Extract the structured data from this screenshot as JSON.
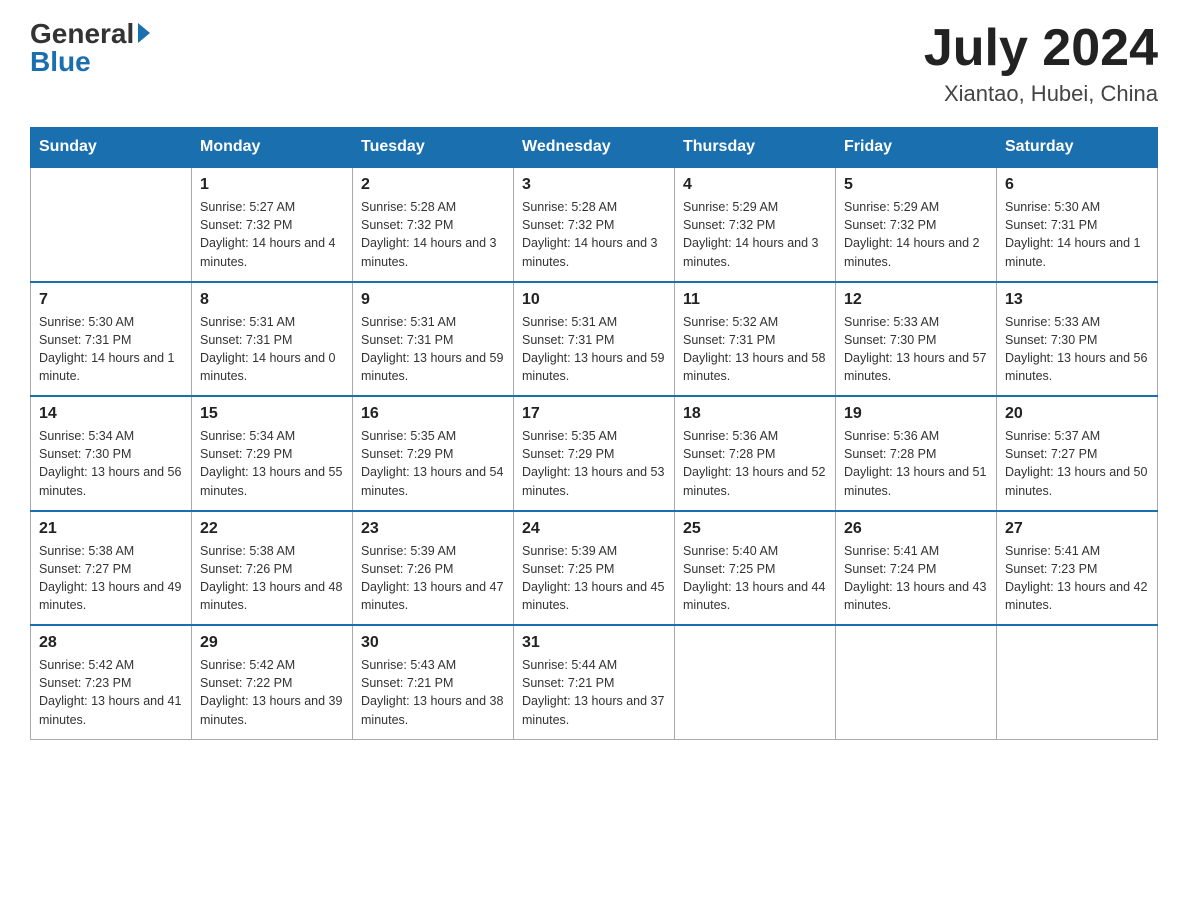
{
  "logo": {
    "general": "General",
    "blue": "Blue",
    "arrow": true
  },
  "title": {
    "month_year": "July 2024",
    "location": "Xiantao, Hubei, China"
  },
  "headers": [
    "Sunday",
    "Monday",
    "Tuesday",
    "Wednesday",
    "Thursday",
    "Friday",
    "Saturday"
  ],
  "weeks": [
    [
      {
        "day": "",
        "sunrise": "",
        "sunset": "",
        "daylight": ""
      },
      {
        "day": "1",
        "sunrise": "Sunrise: 5:27 AM",
        "sunset": "Sunset: 7:32 PM",
        "daylight": "Daylight: 14 hours and 4 minutes."
      },
      {
        "day": "2",
        "sunrise": "Sunrise: 5:28 AM",
        "sunset": "Sunset: 7:32 PM",
        "daylight": "Daylight: 14 hours and 3 minutes."
      },
      {
        "day": "3",
        "sunrise": "Sunrise: 5:28 AM",
        "sunset": "Sunset: 7:32 PM",
        "daylight": "Daylight: 14 hours and 3 minutes."
      },
      {
        "day": "4",
        "sunrise": "Sunrise: 5:29 AM",
        "sunset": "Sunset: 7:32 PM",
        "daylight": "Daylight: 14 hours and 3 minutes."
      },
      {
        "day": "5",
        "sunrise": "Sunrise: 5:29 AM",
        "sunset": "Sunset: 7:32 PM",
        "daylight": "Daylight: 14 hours and 2 minutes."
      },
      {
        "day": "6",
        "sunrise": "Sunrise: 5:30 AM",
        "sunset": "Sunset: 7:31 PM",
        "daylight": "Daylight: 14 hours and 1 minute."
      }
    ],
    [
      {
        "day": "7",
        "sunrise": "Sunrise: 5:30 AM",
        "sunset": "Sunset: 7:31 PM",
        "daylight": "Daylight: 14 hours and 1 minute."
      },
      {
        "day": "8",
        "sunrise": "Sunrise: 5:31 AM",
        "sunset": "Sunset: 7:31 PM",
        "daylight": "Daylight: 14 hours and 0 minutes."
      },
      {
        "day": "9",
        "sunrise": "Sunrise: 5:31 AM",
        "sunset": "Sunset: 7:31 PM",
        "daylight": "Daylight: 13 hours and 59 minutes."
      },
      {
        "day": "10",
        "sunrise": "Sunrise: 5:31 AM",
        "sunset": "Sunset: 7:31 PM",
        "daylight": "Daylight: 13 hours and 59 minutes."
      },
      {
        "day": "11",
        "sunrise": "Sunrise: 5:32 AM",
        "sunset": "Sunset: 7:31 PM",
        "daylight": "Daylight: 13 hours and 58 minutes."
      },
      {
        "day": "12",
        "sunrise": "Sunrise: 5:33 AM",
        "sunset": "Sunset: 7:30 PM",
        "daylight": "Daylight: 13 hours and 57 minutes."
      },
      {
        "day": "13",
        "sunrise": "Sunrise: 5:33 AM",
        "sunset": "Sunset: 7:30 PM",
        "daylight": "Daylight: 13 hours and 56 minutes."
      }
    ],
    [
      {
        "day": "14",
        "sunrise": "Sunrise: 5:34 AM",
        "sunset": "Sunset: 7:30 PM",
        "daylight": "Daylight: 13 hours and 56 minutes."
      },
      {
        "day": "15",
        "sunrise": "Sunrise: 5:34 AM",
        "sunset": "Sunset: 7:29 PM",
        "daylight": "Daylight: 13 hours and 55 minutes."
      },
      {
        "day": "16",
        "sunrise": "Sunrise: 5:35 AM",
        "sunset": "Sunset: 7:29 PM",
        "daylight": "Daylight: 13 hours and 54 minutes."
      },
      {
        "day": "17",
        "sunrise": "Sunrise: 5:35 AM",
        "sunset": "Sunset: 7:29 PM",
        "daylight": "Daylight: 13 hours and 53 minutes."
      },
      {
        "day": "18",
        "sunrise": "Sunrise: 5:36 AM",
        "sunset": "Sunset: 7:28 PM",
        "daylight": "Daylight: 13 hours and 52 minutes."
      },
      {
        "day": "19",
        "sunrise": "Sunrise: 5:36 AM",
        "sunset": "Sunset: 7:28 PM",
        "daylight": "Daylight: 13 hours and 51 minutes."
      },
      {
        "day": "20",
        "sunrise": "Sunrise: 5:37 AM",
        "sunset": "Sunset: 7:27 PM",
        "daylight": "Daylight: 13 hours and 50 minutes."
      }
    ],
    [
      {
        "day": "21",
        "sunrise": "Sunrise: 5:38 AM",
        "sunset": "Sunset: 7:27 PM",
        "daylight": "Daylight: 13 hours and 49 minutes."
      },
      {
        "day": "22",
        "sunrise": "Sunrise: 5:38 AM",
        "sunset": "Sunset: 7:26 PM",
        "daylight": "Daylight: 13 hours and 48 minutes."
      },
      {
        "day": "23",
        "sunrise": "Sunrise: 5:39 AM",
        "sunset": "Sunset: 7:26 PM",
        "daylight": "Daylight: 13 hours and 47 minutes."
      },
      {
        "day": "24",
        "sunrise": "Sunrise: 5:39 AM",
        "sunset": "Sunset: 7:25 PM",
        "daylight": "Daylight: 13 hours and 45 minutes."
      },
      {
        "day": "25",
        "sunrise": "Sunrise: 5:40 AM",
        "sunset": "Sunset: 7:25 PM",
        "daylight": "Daylight: 13 hours and 44 minutes."
      },
      {
        "day": "26",
        "sunrise": "Sunrise: 5:41 AM",
        "sunset": "Sunset: 7:24 PM",
        "daylight": "Daylight: 13 hours and 43 minutes."
      },
      {
        "day": "27",
        "sunrise": "Sunrise: 5:41 AM",
        "sunset": "Sunset: 7:23 PM",
        "daylight": "Daylight: 13 hours and 42 minutes."
      }
    ],
    [
      {
        "day": "28",
        "sunrise": "Sunrise: 5:42 AM",
        "sunset": "Sunset: 7:23 PM",
        "daylight": "Daylight: 13 hours and 41 minutes."
      },
      {
        "day": "29",
        "sunrise": "Sunrise: 5:42 AM",
        "sunset": "Sunset: 7:22 PM",
        "daylight": "Daylight: 13 hours and 39 minutes."
      },
      {
        "day": "30",
        "sunrise": "Sunrise: 5:43 AM",
        "sunset": "Sunset: 7:21 PM",
        "daylight": "Daylight: 13 hours and 38 minutes."
      },
      {
        "day": "31",
        "sunrise": "Sunrise: 5:44 AM",
        "sunset": "Sunset: 7:21 PM",
        "daylight": "Daylight: 13 hours and 37 minutes."
      },
      {
        "day": "",
        "sunrise": "",
        "sunset": "",
        "daylight": ""
      },
      {
        "day": "",
        "sunrise": "",
        "sunset": "",
        "daylight": ""
      },
      {
        "day": "",
        "sunrise": "",
        "sunset": "",
        "daylight": ""
      }
    ]
  ]
}
